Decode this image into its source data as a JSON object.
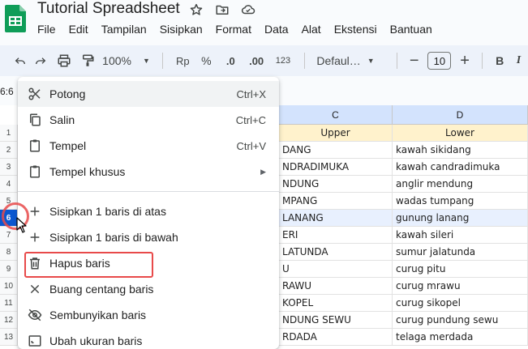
{
  "app": {
    "title": "Tutorial Spreadsheet",
    "brand_color": "#0f9d58"
  },
  "menubar": [
    "File",
    "Edit",
    "Tampilan",
    "Sisipkan",
    "Format",
    "Data",
    "Alat",
    "Ekstensi",
    "Bantuan"
  ],
  "toolbar": {
    "zoom": "100%",
    "currency": "Rp",
    "percent": "%",
    "dec_decrease": ".0",
    "dec_increase": ".00",
    "number_format": "123",
    "font": "Defaul…",
    "font_size": "10",
    "bold": "B",
    "italic": "I"
  },
  "namebox": "6:6",
  "columns": {
    "c_header": "C",
    "d_header": "D"
  },
  "rows": [
    "1",
    "2",
    "3",
    "4",
    "5",
    "6",
    "7",
    "8",
    "9",
    "10",
    "11",
    "12",
    "13"
  ],
  "selected_row": "6",
  "table": {
    "header": {
      "c": "Upper",
      "d": "Lower"
    },
    "body": [
      {
        "c": "DANG",
        "d": "kawah sikidang"
      },
      {
        "c": "NDRADIMUKA",
        "d": "kawah candradimuka"
      },
      {
        "c": "NDUNG",
        "d": "anglir mendung"
      },
      {
        "c": "MPANG",
        "d": "wadas tumpang"
      },
      {
        "c": "LANANG",
        "d": "gunung lanang"
      },
      {
        "c": "ERI",
        "d": "kawah sileri"
      },
      {
        "c": "LATUNDA",
        "d": "sumur jalatunda"
      },
      {
        "c": "U",
        "d": "curug pitu"
      },
      {
        "c": "RAWU",
        "d": "curug mrawu"
      },
      {
        "c": "KOPEL",
        "d": "curug sikopel"
      },
      {
        "c": "NDUNG SEWU",
        "d": "curug pundung sewu"
      },
      {
        "c": "RDADA",
        "d": "telaga merdada"
      }
    ]
  },
  "context_menu": {
    "items": [
      {
        "label": "Potong",
        "shortcut": "Ctrl+X",
        "icon": "scissors-icon"
      },
      {
        "label": "Salin",
        "shortcut": "Ctrl+C",
        "icon": "copy-icon"
      },
      {
        "label": "Tempel",
        "shortcut": "Ctrl+V",
        "icon": "clipboard-icon"
      },
      {
        "label": "Tempel khusus",
        "shortcut": "",
        "icon": "clipboard-icon"
      },
      {
        "label": "Sisipkan 1 baris di atas",
        "shortcut": "",
        "icon": "plus-icon"
      },
      {
        "label": "Sisipkan 1 baris di bawah",
        "shortcut": "",
        "icon": "plus-icon"
      },
      {
        "label": "Hapus baris",
        "shortcut": "",
        "icon": "trash-icon"
      },
      {
        "label": "Buang centang baris",
        "shortcut": "",
        "icon": "close-icon"
      },
      {
        "label": "Sembunyikan baris",
        "shortcut": "",
        "icon": "eye-off-icon"
      },
      {
        "label": "Ubah ukuran baris",
        "shortcut": "",
        "icon": "resize-icon"
      }
    ]
  },
  "colors": {
    "header_fill": "#fff2cc",
    "selection": "#0b57d0",
    "annotation": "#e84a4a"
  }
}
